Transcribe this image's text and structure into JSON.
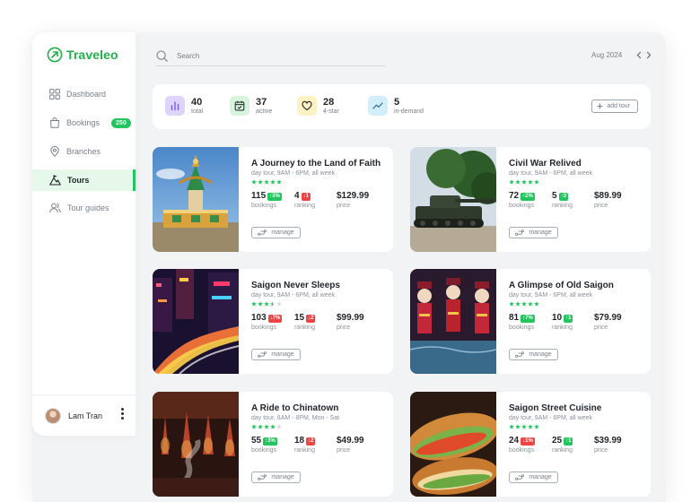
{
  "app": {
    "name": "Traveleo",
    "brand_color": "#22b04b"
  },
  "sidebar": {
    "items": [
      {
        "label": "Dashboard",
        "icon": "dashboard-icon"
      },
      {
        "label": "Bookings",
        "icon": "shopping-bag-icon",
        "badge": "250"
      },
      {
        "label": "Branches",
        "icon": "map-pin-icon"
      },
      {
        "label": "Tours",
        "icon": "mountain-icon",
        "active": true
      },
      {
        "label": "Tour guides",
        "icon": "users-icon"
      }
    ],
    "user": {
      "name": "Lam Tran"
    }
  },
  "header": {
    "search_placeholder": "Search",
    "date": "Aug 2024"
  },
  "stats": [
    {
      "value": "40",
      "label": "total",
      "icon": "bar-chart-icon",
      "bg": "#ddd5fb",
      "fg": "#7c5be0"
    },
    {
      "value": "37",
      "label": "active",
      "icon": "calendar-check-icon",
      "bg": "#d6f5dc",
      "fg": "#22a04b"
    },
    {
      "value": "28",
      "label": "4-star",
      "icon": "heart-icon",
      "bg": "#fdf2c4",
      "fg": "#c9a008"
    },
    {
      "value": "5",
      "label": "in-demand",
      "icon": "trend-icon",
      "bg": "#d2eefa",
      "fg": "#2a9fd0"
    }
  ],
  "add_tour_label": "add tour",
  "tours": [
    {
      "title": "A Journey to the Land of Faith",
      "schedule": "day tour, 9AM - 6PM, all week",
      "stars": 5,
      "bookings": "115",
      "bookings_change": "3%",
      "bookings_trend": "up",
      "ranking": "4",
      "ranking_change": "1",
      "ranking_trend": "down",
      "price": "$129.99",
      "image": "temple-statue"
    },
    {
      "title": "Civil War Relived",
      "schedule": "day tour, 9AM - 6PM, all week",
      "stars": 5,
      "bookings": "72",
      "bookings_change": "2%",
      "bookings_trend": "up",
      "ranking": "5",
      "ranking_change": "3",
      "ranking_trend": "up",
      "price": "$89.99",
      "image": "tank"
    },
    {
      "title": "Saigon Never Sleeps",
      "schedule": "day tour, 9AM - 6PM, all week",
      "stars": 3.5,
      "bookings": "103",
      "bookings_change": "7%",
      "bookings_trend": "down",
      "ranking": "15",
      "ranking_change": "2",
      "ranking_trend": "down",
      "price": "$99.99",
      "image": "night-city"
    },
    {
      "title": "A Glimpse of Old Saigon",
      "schedule": "day tour, 9AM - 6PM, all week",
      "stars": 5,
      "bookings": "81",
      "bookings_change": "7%",
      "bookings_trend": "up",
      "ranking": "10",
      "ranking_change": "1",
      "ranking_trend": "up",
      "price": "$79.99",
      "image": "water-puppets"
    },
    {
      "title": "A Ride to Chinatown",
      "schedule": "day tour, 8AM - 8PM, Mon - Sat",
      "stars": 4,
      "bookings": "55",
      "bookings_change": "3%",
      "bookings_trend": "up",
      "ranking": "18",
      "ranking_change": "2",
      "ranking_trend": "down",
      "price": "$49.99",
      "image": "incense-pagoda"
    },
    {
      "title": "Saigon Street Cuisine",
      "schedule": "day tour, 9AM - 6PM, all week",
      "stars": 5,
      "bookings": "24",
      "bookings_change": "1%",
      "bookings_trend": "down",
      "ranking": "25",
      "ranking_change": "1",
      "ranking_trend": "up",
      "price": "$39.99",
      "image": "banh-mi"
    }
  ],
  "labels": {
    "bookings": "bookings",
    "ranking": "ranking",
    "price": "price",
    "manage": "manage"
  }
}
